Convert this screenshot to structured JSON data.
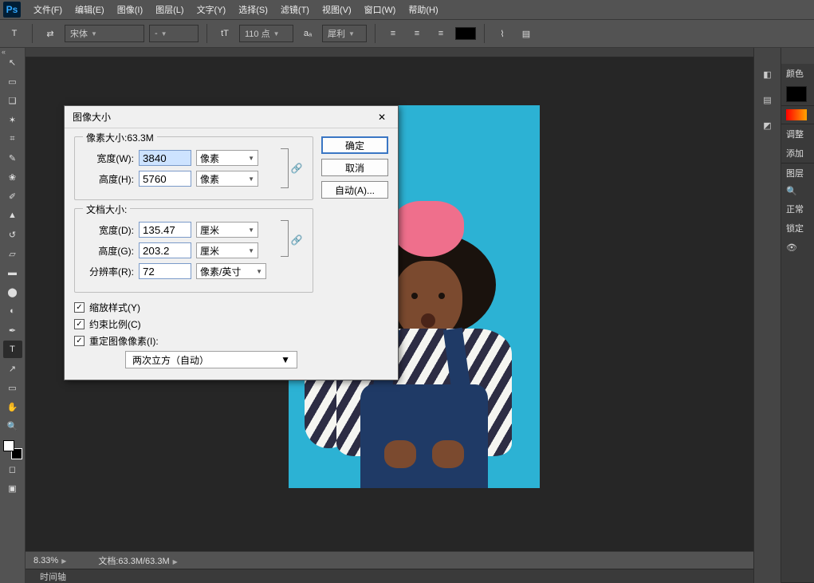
{
  "app": {
    "logo_text": "Ps"
  },
  "menubar": {
    "items": [
      "文件(F)",
      "编辑(E)",
      "图像(I)",
      "图层(L)",
      "文字(Y)",
      "选择(S)",
      "滤镜(T)",
      "视图(V)",
      "窗口(W)",
      "帮助(H)"
    ]
  },
  "optbar": {
    "tool_glyph": "T",
    "toggle_glyph": "⇄",
    "font_family": "宋体",
    "font_style": "-",
    "size_glyph": "tT",
    "font_size": "110 点",
    "aa_glyph": "aₐ",
    "aa_mode": "犀利",
    "warp_glyph": "⌇"
  },
  "toolbar": {
    "tools": [
      {
        "name": "move",
        "glyph": "↖"
      },
      {
        "name": "marquee",
        "glyph": "▭"
      },
      {
        "name": "lasso",
        "glyph": "❑"
      },
      {
        "name": "quick-select",
        "glyph": "✶"
      },
      {
        "name": "crop",
        "glyph": "⌗"
      },
      {
        "name": "eyedropper",
        "glyph": "✎"
      },
      {
        "name": "healing",
        "glyph": "❀"
      },
      {
        "name": "brush",
        "glyph": "✐"
      },
      {
        "name": "stamp",
        "glyph": "▲"
      },
      {
        "name": "history-brush",
        "glyph": "↺"
      },
      {
        "name": "eraser",
        "glyph": "▱"
      },
      {
        "name": "gradient",
        "glyph": "▬"
      },
      {
        "name": "blur",
        "glyph": "⬤"
      },
      {
        "name": "dodge",
        "glyph": "◐"
      },
      {
        "name": "pen",
        "glyph": "✒"
      },
      {
        "name": "type",
        "glyph": "T",
        "active": true
      },
      {
        "name": "path-select",
        "glyph": "↗"
      },
      {
        "name": "shape",
        "glyph": "▭"
      },
      {
        "name": "hand",
        "glyph": "✋"
      },
      {
        "name": "zoom",
        "glyph": "🔍"
      }
    ]
  },
  "right": {
    "color_label": "颜色",
    "adjust_label": "调整",
    "add_label": "添加",
    "layers_label": "图层",
    "search_glyph": "🔍",
    "normal_label": "正常",
    "lock_label": "锁定",
    "eye_glyph": "👁"
  },
  "status": {
    "zoom": "8.33%",
    "doc_label": "文档:",
    "doc_size": "63.3M/63.3M",
    "timeline_label": "时间轴"
  },
  "dialog": {
    "title": "图像大小",
    "close_glyph": "✕",
    "pixel_legend_prefix": "像素大小:",
    "pixel_size": "63.3M",
    "width_label": "宽度(W):",
    "width_value": "3840",
    "height_label": "高度(H):",
    "height_value": "5760",
    "unit_px": "像素",
    "doc_legend": "文档大小:",
    "doc_width_label": "宽度(D):",
    "doc_width_value": "135.47",
    "doc_height_label": "高度(G):",
    "doc_height_value": "203.2",
    "unit_cm": "厘米",
    "res_label": "分辨率(R):",
    "res_value": "72",
    "unit_ppi": "像素/英寸",
    "link_glyph": "🔗",
    "chk_scale": "缩放样式(Y)",
    "chk_constrain": "约束比例(C)",
    "chk_resample": "重定图像像素(I):",
    "resample_mode": "两次立方（自动）",
    "btn_ok": "确定",
    "btn_cancel": "取消",
    "btn_auto": "自动(A)..."
  }
}
